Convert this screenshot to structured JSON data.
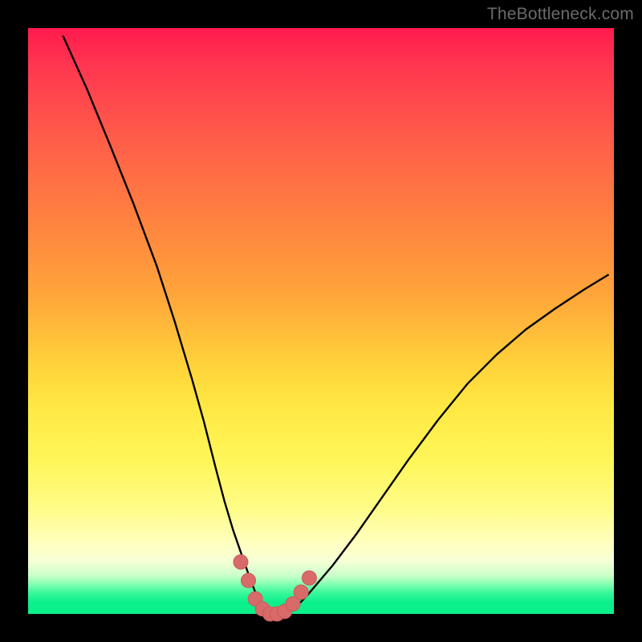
{
  "watermark": {
    "text": "TheBottleneck.com"
  },
  "colors": {
    "frame": "#000000",
    "curve": "#000000",
    "marker": "#d86a6a",
    "marker_stroke": "#c95b5b"
  },
  "chart_data": {
    "type": "line",
    "title": "",
    "xlabel": "",
    "ylabel": "",
    "xlim": [
      0,
      100
    ],
    "ylim": [
      0,
      700
    ],
    "grid": false,
    "legend": false,
    "series": [
      {
        "name": "bottleneck-curve",
        "x": [
          6,
          10,
          14,
          18,
          22,
          25,
          28,
          30,
          32,
          33.5,
          35,
          36.5,
          38,
          39,
          40,
          41,
          42,
          43,
          44,
          46,
          48,
          52,
          56,
          60,
          65,
          70,
          75,
          80,
          85,
          90,
          95,
          99
        ],
        "y": [
          690,
          628,
          560,
          490,
          415,
          350,
          280,
          230,
          175,
          135,
          100,
          70,
          40,
          22,
          10,
          3,
          0,
          0,
          3,
          10,
          25,
          58,
          95,
          135,
          185,
          232,
          275,
          310,
          340,
          365,
          388,
          405
        ]
      }
    ],
    "markers": {
      "name": "highlight-points",
      "x": [
        36.3,
        37.6,
        38.8,
        40.0,
        41.3,
        42.5,
        43.8,
        45.2,
        46.6,
        48.0
      ],
      "y": [
        62,
        40,
        18,
        6,
        0,
        0,
        3,
        12,
        26,
        43
      ]
    }
  }
}
